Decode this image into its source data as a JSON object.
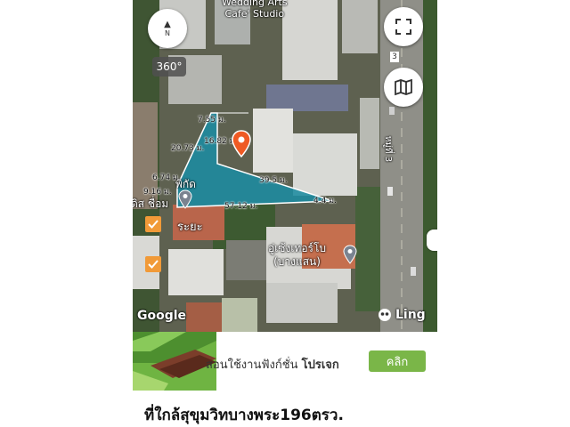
{
  "map": {
    "place_label": "Wedding Arts\nCafe' Studio",
    "compass_label": "N",
    "view360_label": "360°",
    "pin_label": "พิกัด",
    "left_place_label": "ดิส ชื่อม",
    "distance_label": "ระยะ",
    "bottom_place_label": "อู่เซ้งเทอร์โบ\n(บางแสน)",
    "road_label": "หมู่ที่ 3",
    "road_number": "3",
    "measurements": [
      "7.55 ม.",
      "16.82 ม.",
      "20.73 ม.",
      "6.74 ม.",
      "39.5 ม.",
      "4.4 ม.",
      "57.12 ม.",
      "9.16 ม."
    ],
    "watermark": "Google",
    "brand": "Ling"
  },
  "banner": {
    "text_prefix": "สอนใช้งานฟังก์ชั่น ",
    "text_bold": "โปรเจก",
    "cta": "คลิก"
  },
  "page": {
    "title": "ที่ใกล้สุขุมวิทบางพระ196ตรว."
  },
  "colors": {
    "plot": "#1d8ba0",
    "pin": "#ef5a24",
    "checkbox": "#f19a38",
    "cta": "#7ab648",
    "banner_green": "#6fb442"
  }
}
